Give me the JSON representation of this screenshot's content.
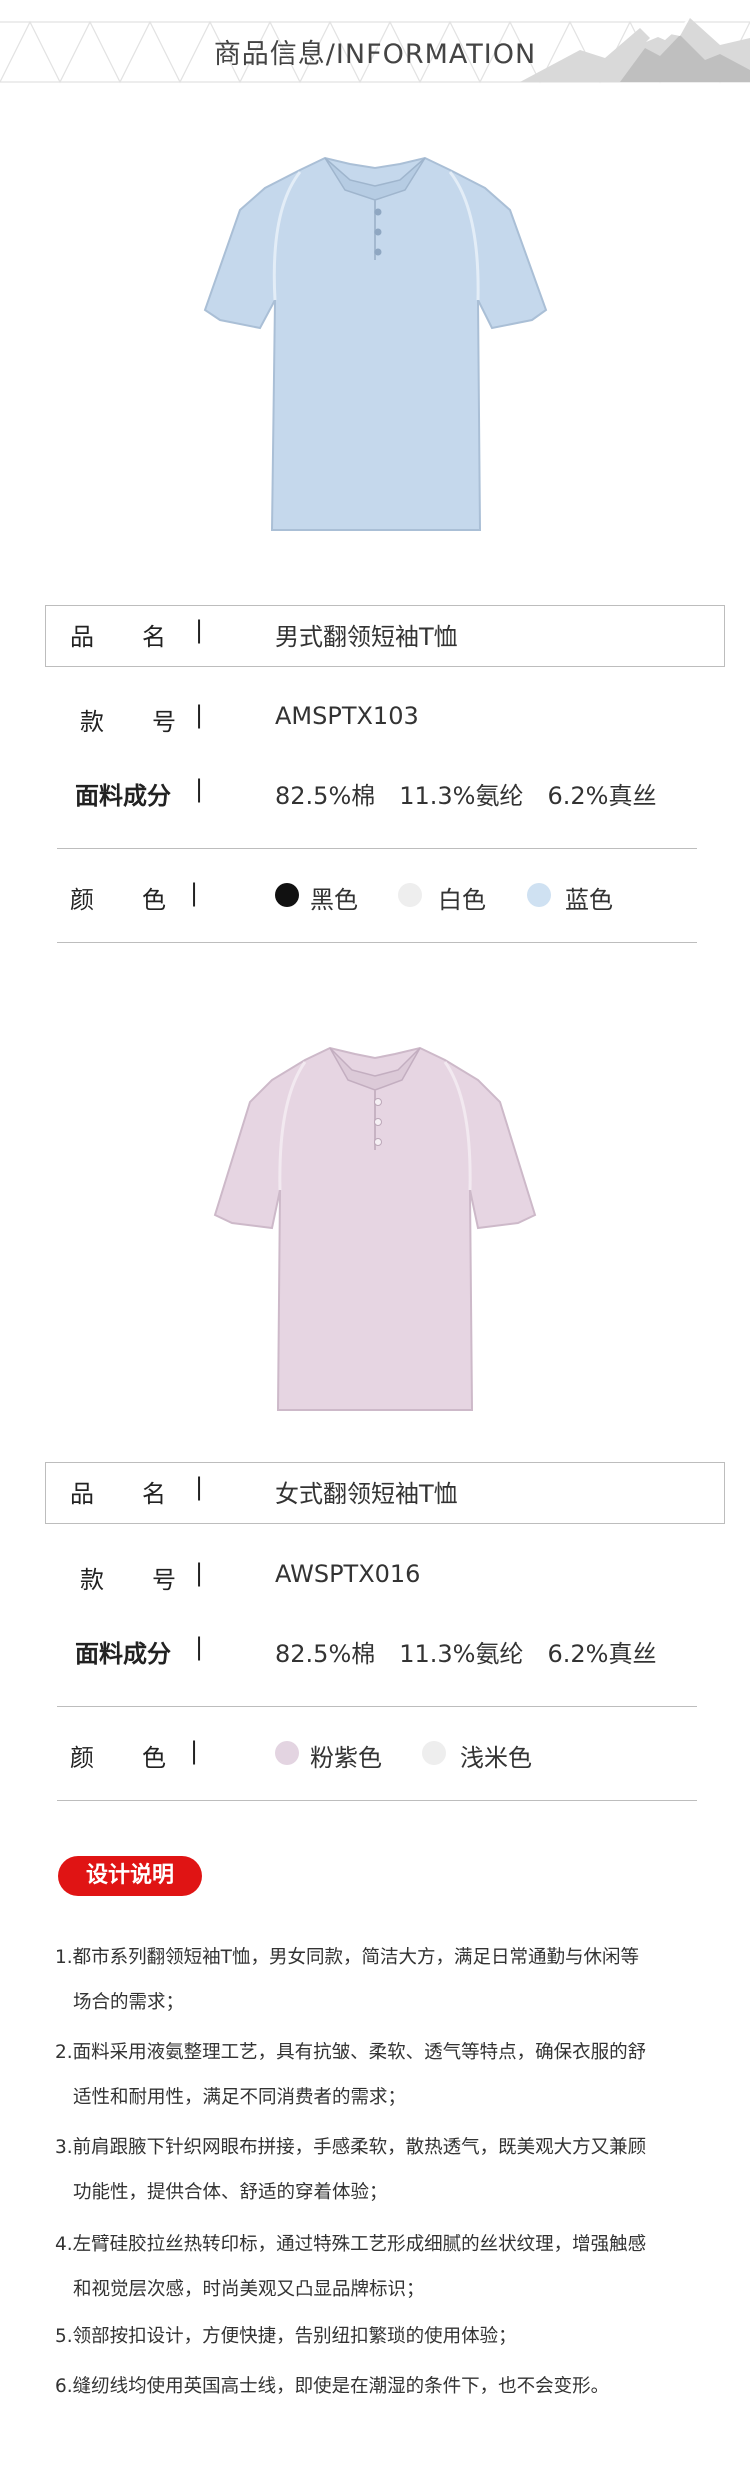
{
  "header": {
    "title": "商品信息/INFORMATION"
  },
  "products": [
    {
      "image_icon": "blue-polo-shirt-image",
      "shirt_color": "#c5d8ec",
      "name_label": "品　　名",
      "name_value": "男式翻领短袖T恤",
      "code_label": "款　　号",
      "code_value": "AMSPTX103",
      "fabric_label": "面料成分",
      "fabric_value": "82.5%棉　11.3%氨纶　6.2%真丝",
      "color_label": "颜　　色",
      "colors": [
        {
          "name": "黑色",
          "hex": "#111111"
        },
        {
          "name": "白色",
          "hex": "#eeeeee"
        },
        {
          "name": "蓝色",
          "hex": "#cfe1f2"
        }
      ]
    },
    {
      "image_icon": "pink-polo-shirt-image",
      "shirt_color": "#e6d5e2",
      "name_label": "品　　名",
      "name_value": "女式翻领短袖T恤",
      "code_label": "款　　号",
      "code_value": "AWSPTX016",
      "fabric_label": "面料成分",
      "fabric_value": "82.5%棉　11.3%氨纶　6.2%真丝",
      "color_label": "颜　　色",
      "colors": [
        {
          "name": "粉紫色",
          "hex": "#e3d4e1"
        },
        {
          "name": "浅米色",
          "hex": "#eeeeee"
        }
      ]
    }
  ],
  "separator": "|",
  "design": {
    "badge": "设计说明",
    "badge_color": "#e01414",
    "notes": [
      [
        "1.都市系列翻领短袖T恤，男女同款，简洁大方，满足日常通勤与休闲等",
        "场合的需求；"
      ],
      [
        "2.面料采用液氨整理工艺，具有抗皱、柔软、透气等特点，确保衣服的舒",
        "适性和耐用性，满足不同消费者的需求；"
      ],
      [
        "3.前肩跟腋下针织网眼布拼接，手感柔软，散热透气，既美观大方又兼顾",
        "功能性，提供合体、舒适的穿着体验；"
      ],
      [
        "4.左臂硅胶拉丝热转印标，通过特殊工艺形成细腻的丝状纹理，增强触感",
        "和视觉层次感，时尚美观又凸显品牌标识；"
      ],
      [
        "5.领部按扣设计，方便快捷，告别纽扣繁琐的使用体验；"
      ],
      [
        "6.缝纫线均使用英国高士线，即使是在潮湿的条件下，也不会变形。"
      ]
    ]
  }
}
